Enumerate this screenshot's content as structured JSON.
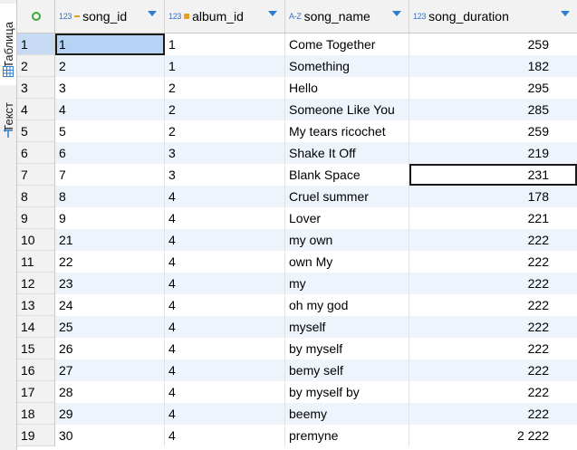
{
  "side_tabs": {
    "table": "Таблица",
    "text": "Текст"
  },
  "columns": [
    {
      "name": "song_id",
      "type": "123"
    },
    {
      "name": "album_id",
      "type": "123"
    },
    {
      "name": "song_name",
      "type": "A-Z"
    },
    {
      "name": "song_duration",
      "type": "123"
    }
  ],
  "rows": [
    {
      "n": "1",
      "id": "1",
      "album": "1",
      "name": "Come Together",
      "dur": "259"
    },
    {
      "n": "2",
      "id": "2",
      "album": "1",
      "name": "Something",
      "dur": "182"
    },
    {
      "n": "3",
      "id": "3",
      "album": "2",
      "name": "Hello",
      "dur": "295"
    },
    {
      "n": "4",
      "id": "4",
      "album": "2",
      "name": "Someone Like You",
      "dur": "285"
    },
    {
      "n": "5",
      "id": "5",
      "album": "2",
      "name": "My tears ricochet",
      "dur": "259"
    },
    {
      "n": "6",
      "id": "6",
      "album": "3",
      "name": "Shake It Off",
      "dur": "219"
    },
    {
      "n": "7",
      "id": "7",
      "album": "3",
      "name": "Blank Space",
      "dur": "231"
    },
    {
      "n": "8",
      "id": "8",
      "album": "4",
      "name": "Cruel summer",
      "dur": "178"
    },
    {
      "n": "9",
      "id": "9",
      "album": "4",
      "name": "Lover",
      "dur": "221"
    },
    {
      "n": "10",
      "id": "21",
      "album": "4",
      "name": "my own",
      "dur": "222"
    },
    {
      "n": "11",
      "id": "22",
      "album": "4",
      "name": "own My",
      "dur": "222"
    },
    {
      "n": "12",
      "id": "23",
      "album": "4",
      "name": "my",
      "dur": "222"
    },
    {
      "n": "13",
      "id": "24",
      "album": "4",
      "name": "oh my god",
      "dur": "222"
    },
    {
      "n": "14",
      "id": "25",
      "album": "4",
      "name": "myself",
      "dur": "222"
    },
    {
      "n": "15",
      "id": "26",
      "album": "4",
      "name": "by myself",
      "dur": "222"
    },
    {
      "n": "16",
      "id": "27",
      "album": "4",
      "name": "bemy self",
      "dur": "222"
    },
    {
      "n": "17",
      "id": "28",
      "album": "4",
      "name": "by myself by",
      "dur": "222"
    },
    {
      "n": "18",
      "id": "29",
      "album": "4",
      "name": "beemy",
      "dur": "222"
    },
    {
      "n": "19",
      "id": "30",
      "album": "4",
      "name": "premyne",
      "dur": "2 222"
    }
  ]
}
